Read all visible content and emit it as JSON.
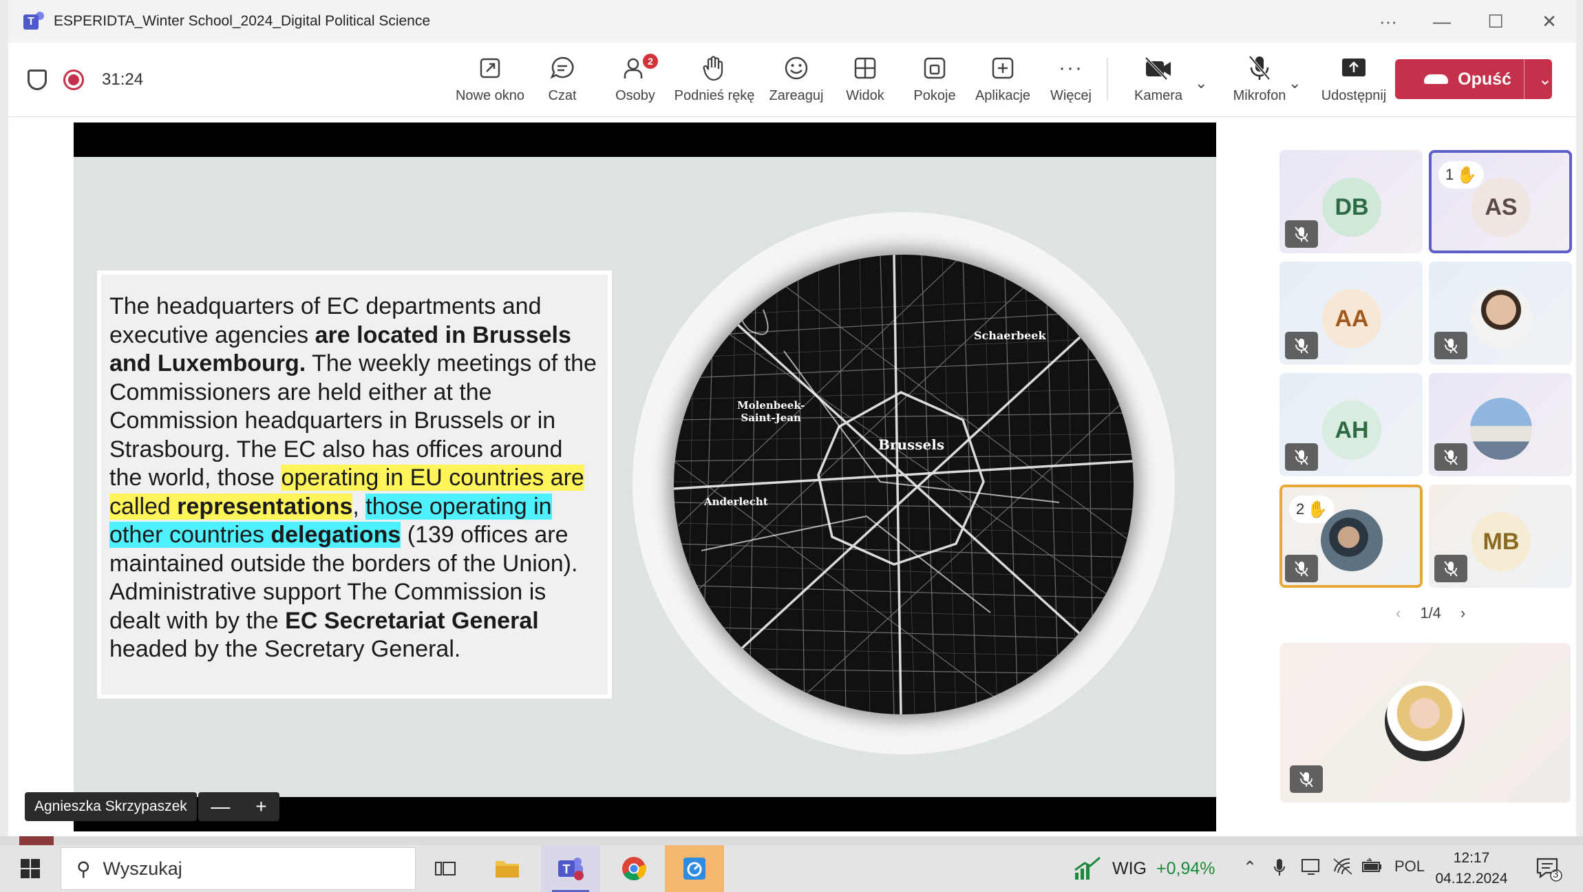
{
  "window": {
    "title": "ESPERIDTA_Winter School_2024_Digital Political Science"
  },
  "toolbar": {
    "timer": "31:24",
    "buttons": [
      {
        "label": "Nowe okno",
        "icon": "popout-icon"
      },
      {
        "label": "Czat",
        "icon": "chat-icon"
      },
      {
        "label": "Osoby",
        "icon": "people-icon",
        "badge": "2"
      },
      {
        "label": "Podnieś rękę",
        "icon": "raise-hand-icon"
      },
      {
        "label": "Zareaguj",
        "icon": "react-icon"
      },
      {
        "label": "Widok",
        "icon": "view-icon"
      },
      {
        "label": "Pokoje",
        "icon": "rooms-icon"
      },
      {
        "label": "Aplikacje",
        "icon": "apps-icon"
      },
      {
        "label": "Więcej",
        "icon": "more-icon"
      }
    ],
    "camera_label": "Kamera",
    "mic_label": "Mikrofon",
    "share_label": "Udostępnij",
    "leave_label": "Opuść",
    "leave_color": "#c4314b"
  },
  "slide": {
    "p1": "The headquarters of EC departments and executive agencies ",
    "p1b": "are located in Brussels and Luxembourg.",
    "p2": " The weekly meetings of the Commissioners are held either at the Commission headquarters in Brussels or in Strasbourg. The EC also has offices around the world, those ",
    "hl1": "operating in EU countries are called ",
    "hl1b": "representations",
    "comma": ", ",
    "hl2": "those operating in other countries ",
    "hl2b": "delegations",
    "p3": " (139 offices are maintained outside the borders of the Union). Administrative support The Commission is dealt with by the ",
    "p3b": "EC Secretariat General",
    "p4": " headed by the Secretary General.",
    "map_labels": {
      "schaerbeek": "Schaerbeek",
      "molenbeek1": "Molenbeek-",
      "molenbeek2": "Saint-Jean",
      "brussels": "Brussels",
      "anderlecht": "Anderlecht"
    }
  },
  "presenter": {
    "name": "Agnieszka Skrzypaszek",
    "zoom_out": "—",
    "zoom_in": "+"
  },
  "participants": [
    {
      "initials": "DB",
      "color": "#cfe8d8",
      "text_color": "#2e6b45"
    },
    {
      "initials": "AS",
      "color": "#efe6e2",
      "text_color": "#5a4a44",
      "hand": "1"
    },
    {
      "initials": "AA",
      "color": "#f7e7d4",
      "text_color": "#a05a1e"
    },
    {
      "initials": "",
      "photo": true
    },
    {
      "initials": "AH",
      "color": "#d8ece0",
      "text_color": "#2e6b45"
    },
    {
      "initials": "",
      "photo": true
    },
    {
      "initials": "",
      "photo": true,
      "hand": "2"
    },
    {
      "initials": "MB",
      "color": "#f6ecd4",
      "text_color": "#8a6a20"
    }
  ],
  "pager": {
    "text": "1/4"
  },
  "taskbar": {
    "search_placeholder": "Wyszukaj",
    "wig_name": "WIG",
    "wig_change": "+0,94%",
    "lang": "POL",
    "time": "12:17",
    "date": "04.12.2024",
    "notifications": "3"
  }
}
